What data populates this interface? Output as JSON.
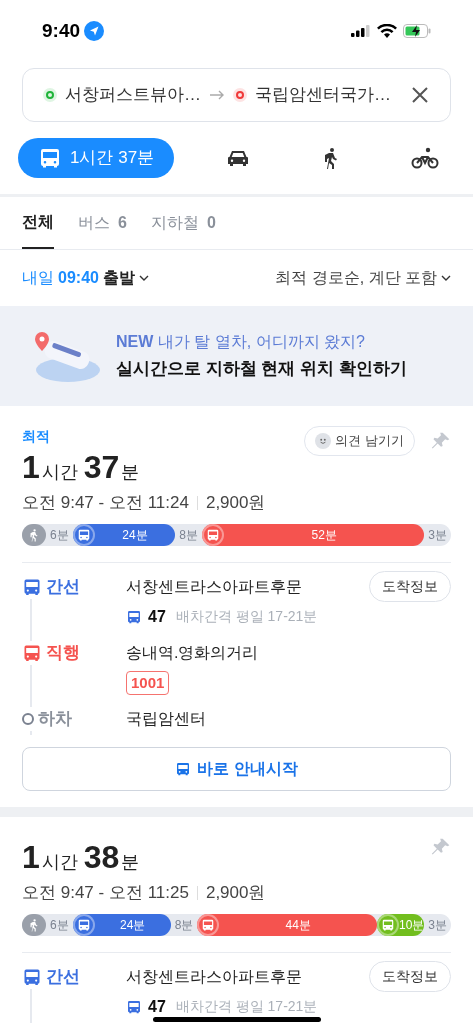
{
  "status_bar": {
    "time": "9:40"
  },
  "search": {
    "origin": "서창퍼스트뷰아…",
    "destination": "국립암센터국가…"
  },
  "modes": [
    {
      "kind": "transit",
      "label": "1시간 37분",
      "selected": true
    },
    {
      "kind": "car",
      "selected": false
    },
    {
      "kind": "walk",
      "selected": false
    },
    {
      "kind": "bike",
      "selected": false
    }
  ],
  "tabs": [
    {
      "label": "전체",
      "selected": true
    },
    {
      "label": "버스",
      "count": "6",
      "selected": false
    },
    {
      "label": "지하철",
      "count": "0",
      "selected": false
    }
  ],
  "departure": {
    "day": "내일",
    "time": "09:40",
    "suffix": "출발"
  },
  "sort": "최적 경로순, 계단 포함",
  "banner": {
    "tag": "NEW",
    "headline": "내가 탈 열차, 어디까지 왔지?",
    "text": "실시간으로 지하철 현재 위치 확인하기"
  },
  "routes": [
    {
      "badge": "최적",
      "feedback": "의견 남기기",
      "duration": [
        {
          "kind": "number",
          "text": "1"
        },
        {
          "kind": "unit",
          "text": "시간"
        },
        {
          "kind": "number",
          "text": "37"
        },
        {
          "kind": "unit",
          "text": "분"
        }
      ],
      "times": "오전 9:47 - 오전 11:24",
      "fare": "2,900원",
      "segments": [
        {
          "kind": "walk"
        },
        {
          "kind": "gap",
          "label": "6분"
        },
        {
          "kind": "bus",
          "color": "#3b6fe0",
          "label": "24분"
        },
        {
          "kind": "gap",
          "label": "8분"
        },
        {
          "kind": "bus",
          "color": "#f5534f",
          "label": "52분"
        },
        {
          "kind": "gap",
          "label": "3분"
        }
      ],
      "steps": [
        {
          "kind": "bus",
          "color": "#3b6fe0",
          "type": "간선",
          "stop": "서창센트라스아파트후문",
          "action": "도착정보",
          "number": "47",
          "interval": "배차간격 평일 17-21분"
        },
        {
          "kind": "express",
          "color": "#f5534f",
          "type": "직행",
          "stop": "송내역.영화의거리",
          "badge": "1001"
        },
        {
          "kind": "alight",
          "type": "하차",
          "stop": "국립암센터"
        }
      ],
      "start": "바로 안내시작"
    },
    {
      "duration": [
        {
          "kind": "number",
          "text": "1"
        },
        {
          "kind": "unit",
          "text": "시간"
        },
        {
          "kind": "number",
          "text": "38"
        },
        {
          "kind": "unit",
          "text": "분"
        }
      ],
      "times": "오전 9:47 - 오전 11:25",
      "fare": "2,900원",
      "segments": [
        {
          "kind": "walk"
        },
        {
          "kind": "gap",
          "label": "6분"
        },
        {
          "kind": "bus",
          "color": "#3b6fe0",
          "label": "24분"
        },
        {
          "kind": "gap",
          "label": "8분"
        },
        {
          "kind": "bus",
          "color": "#f5534f",
          "label": "44분"
        },
        {
          "kind": "bus",
          "color": "#72be1e",
          "label": "10분"
        },
        {
          "kind": "gap",
          "label": "3분"
        }
      ],
      "steps": [
        {
          "kind": "bus",
          "color": "#3b6fe0",
          "type": "간선",
          "stop": "서창센트라스아파트후문",
          "action": "도착정보",
          "number": "47",
          "interval": "배차간격 평일 17-21분"
        }
      ]
    }
  ]
}
